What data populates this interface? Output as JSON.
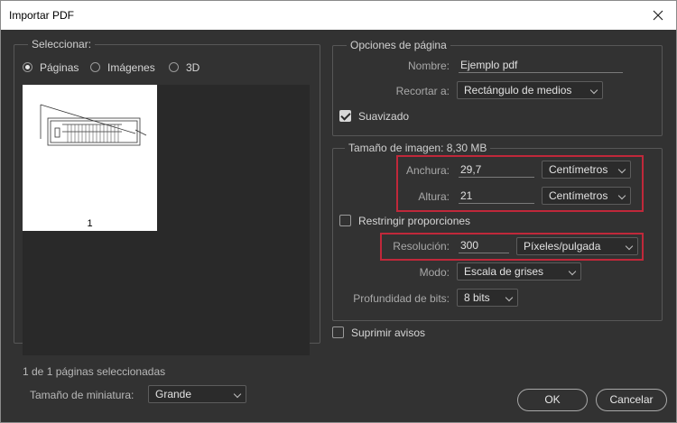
{
  "window": {
    "title": "Importar PDF"
  },
  "select_group": {
    "legend": "Seleccionar:",
    "options": [
      {
        "label": "Páginas",
        "selected": true
      },
      {
        "label": "Imágenes",
        "selected": false
      },
      {
        "label": "3D",
        "selected": false
      }
    ],
    "thumbnail_page": "1",
    "status": "1 de 1 páginas seleccionadas",
    "thumb_size_label": "Tamaño de miniatura:",
    "thumb_size_value": "Grande"
  },
  "page_options": {
    "legend": "Opciones de página",
    "name_label": "Nombre:",
    "name_value": "Ejemplo pdf",
    "crop_label": "Recortar a:",
    "crop_value": "Rectángulo de medios",
    "smooth_label": "Suavizado",
    "smooth_checked": true
  },
  "image_size": {
    "legend": "Tamaño de imagen: 8,30 MB",
    "width_label": "Anchura:",
    "width_value": "29,7",
    "width_unit": "Centímetros",
    "height_label": "Altura:",
    "height_value": "21",
    "height_unit": "Centímetros",
    "constrain_label": "Restringir proporciones",
    "constrain_checked": false,
    "resolution_label": "Resolución:",
    "resolution_value": "300",
    "resolution_unit": "Píxeles/pulgada",
    "mode_label": "Modo:",
    "mode_value": "Escala de grises",
    "depth_label": "Profundidad de bits:",
    "depth_value": "8 bits"
  },
  "suppress_label": "Suprimir avisos",
  "suppress_checked": false,
  "buttons": {
    "ok": "OK",
    "cancel": "Cancelar"
  },
  "colors": {
    "background": "#323232",
    "highlight": "#c0283a"
  }
}
